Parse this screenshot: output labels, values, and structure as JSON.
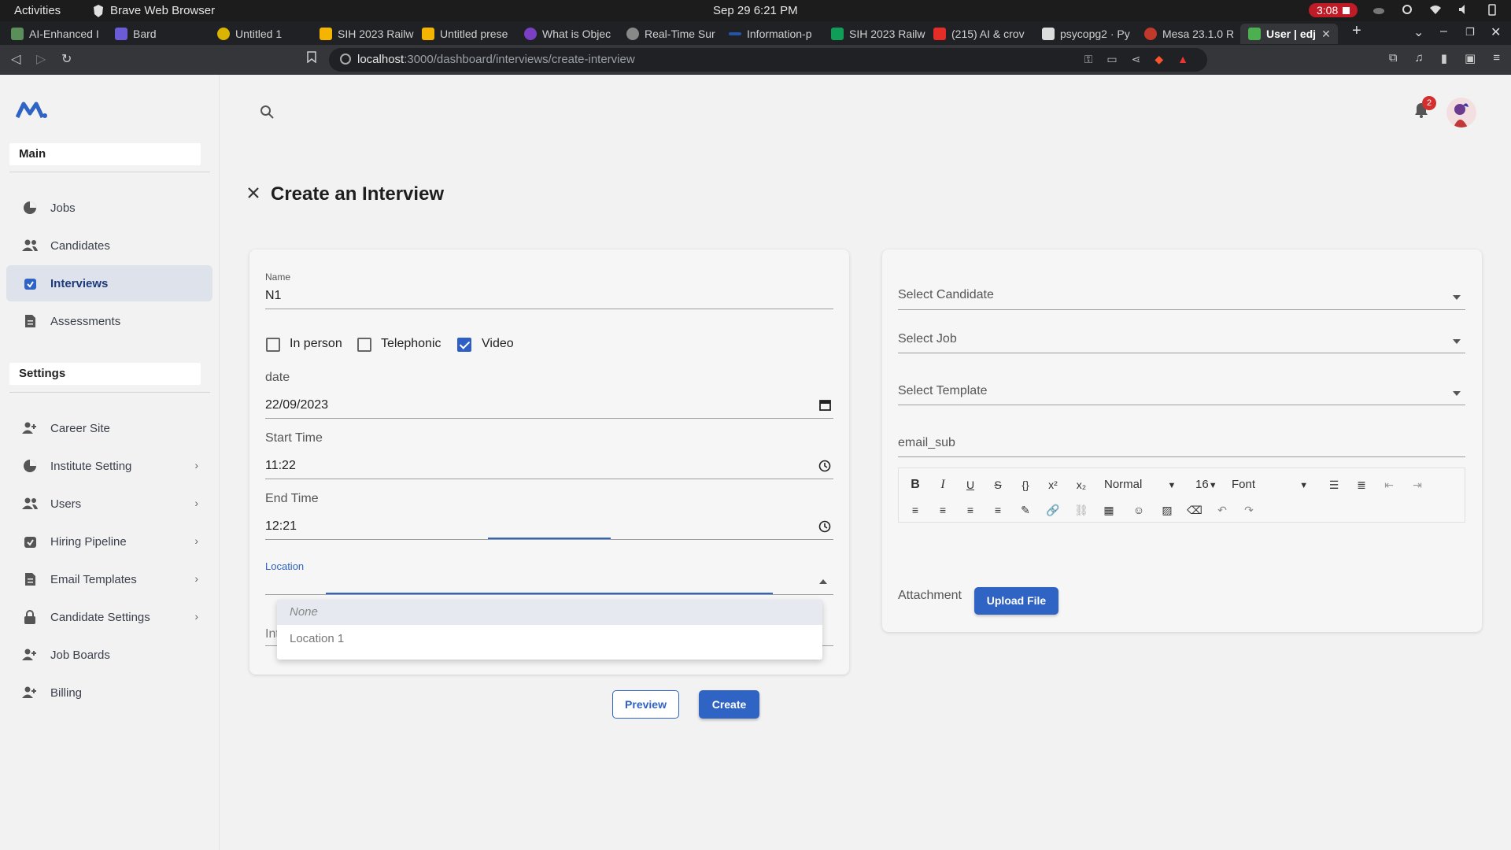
{
  "os": {
    "activities": "Activities",
    "app_name": "Brave Web Browser",
    "clock": "Sep 29  6:21 PM",
    "recording": "3:08"
  },
  "browser": {
    "tabs": [
      {
        "label": "AI-Enhanced I",
        "color": "#5a8f5a"
      },
      {
        "label": "Bard",
        "color": "#6b5bd6"
      },
      {
        "label": "Untitled 1",
        "color": "#d9b400"
      },
      {
        "label": "SIH 2023 Railw",
        "color": "#f4b400"
      },
      {
        "label": "Untitled prese",
        "color": "#f4b400"
      },
      {
        "label": "What is Objec",
        "color": "#7a3fc2"
      },
      {
        "label": "Real-Time Sur",
        "color": "#888888"
      },
      {
        "label": "Information-p",
        "color": "#2255aa"
      },
      {
        "label": "SIH 2023 Railw",
        "color": "#0f9d58"
      },
      {
        "label": "(215) AI & crov",
        "color": "#e52d27"
      },
      {
        "label": "psycopg2 · Py",
        "color": "#dddddd"
      },
      {
        "label": "Mesa 23.1.0 R",
        "color": "#c0392b"
      },
      {
        "label": "User | edj",
        "color": "#4caf50"
      }
    ],
    "url_host": "localhost",
    "url_path": ":3000/dashboard/interviews/create-interview"
  },
  "sidebar": {
    "main_title": "Main",
    "settings_title": "Settings",
    "main_items": [
      {
        "label": "Jobs",
        "icon": "pie-chart-icon"
      },
      {
        "label": "Candidates",
        "icon": "people-icon"
      },
      {
        "label": "Interviews",
        "icon": "calendar-check-icon"
      },
      {
        "label": "Assessments",
        "icon": "document-icon"
      }
    ],
    "settings_items": [
      {
        "label": "Career Site",
        "icon": "person-add-icon"
      },
      {
        "label": "Institute Setting",
        "icon": "pie-chart-icon"
      },
      {
        "label": "Users",
        "icon": "people-icon"
      },
      {
        "label": "Hiring Pipeline",
        "icon": "calendar-check-icon"
      },
      {
        "label": "Email Templates",
        "icon": "document-icon"
      },
      {
        "label": "Candidate Settings",
        "icon": "lock-icon"
      },
      {
        "label": "Job Boards",
        "icon": "person-add-icon"
      },
      {
        "label": "Billing",
        "icon": "person-add-icon"
      }
    ]
  },
  "header": {
    "notification_count": "2"
  },
  "page": {
    "title": "Create an Interview"
  },
  "form": {
    "name_label": "Name",
    "name_value": "N1",
    "mode_options": [
      {
        "label": "In person",
        "checked": false
      },
      {
        "label": "Telephonic",
        "checked": false
      },
      {
        "label": "Video",
        "checked": true
      }
    ],
    "date_label": "date",
    "date_value": "22/09/2023",
    "start_label": "Start Time",
    "start_value": "11:22",
    "end_label": "End Time",
    "end_value": "12:21",
    "location_label": "Location",
    "location_options": [
      "None",
      "Location 1"
    ],
    "interviewer_label": "Interviewer"
  },
  "right_panel": {
    "select_candidate": "Select Candidate",
    "select_job": "Select Job",
    "select_template": "Select Template",
    "email_sub": "email_sub",
    "toolbar": {
      "format": "Normal",
      "size": "16",
      "font": "Font"
    },
    "attachment_label": "Attachment",
    "upload_label": "Upload File"
  },
  "actions": {
    "preview": "Preview",
    "create": "Create"
  },
  "colors": {
    "accent": "#2f63c4",
    "sidebar_active_bg": "#dde2eb",
    "badge": "#d32f2f"
  }
}
